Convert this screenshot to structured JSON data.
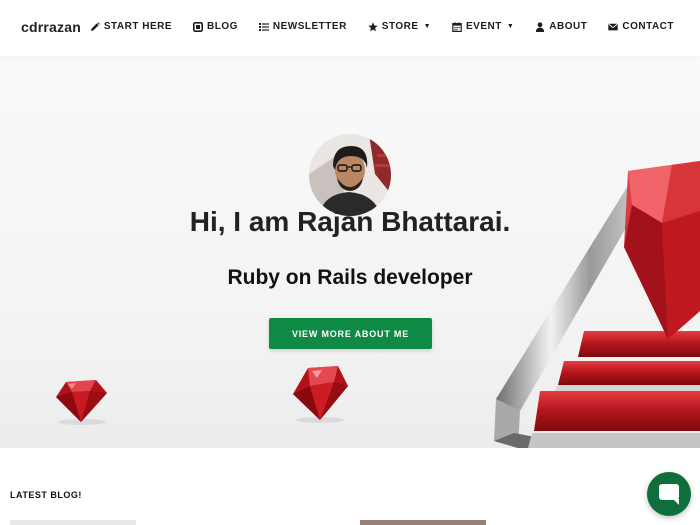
{
  "brand": "cdrrazan",
  "nav": [
    {
      "icon": "pencil-icon",
      "label": "START HERE",
      "dropdown": false
    },
    {
      "icon": "blog-icon",
      "label": "BLOG",
      "dropdown": false
    },
    {
      "icon": "list-icon",
      "label": "NEWSLETTER",
      "dropdown": false
    },
    {
      "icon": "star-icon",
      "label": "STORE",
      "dropdown": true
    },
    {
      "icon": "calendar-icon",
      "label": "EVENT",
      "dropdown": true
    },
    {
      "icon": "user-icon",
      "label": "ABOUT",
      "dropdown": false
    },
    {
      "icon": "envelope-icon",
      "label": "CONTACT",
      "dropdown": false
    }
  ],
  "hero": {
    "title": "Hi, I am Rajan Bhattarai.",
    "subtitle": "Ruby on Rails developer",
    "cta": "VIEW MORE ABOUT ME"
  },
  "blog": {
    "heading": "LATEST BLOG!"
  },
  "colors": {
    "accent": "#0f8a45",
    "chat": "#0f6e3b",
    "ruby": "#c0141c"
  }
}
